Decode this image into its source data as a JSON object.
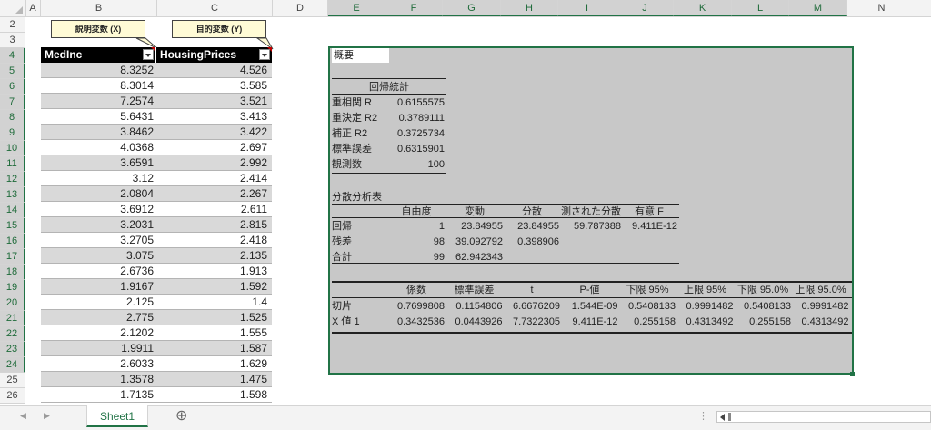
{
  "columns": [
    "A",
    "B",
    "C",
    "D",
    "E",
    "F",
    "G",
    "H",
    "I",
    "J",
    "K",
    "L",
    "M",
    "N"
  ],
  "rows": [
    "2",
    "3",
    "4",
    "5",
    "6",
    "7",
    "8",
    "9",
    "10",
    "11",
    "12",
    "13",
    "14",
    "15",
    "16",
    "17",
    "18",
    "19",
    "20",
    "21",
    "22",
    "23",
    "24",
    "25",
    "26"
  ],
  "callouts": {
    "x_label": "説明変数 (X)",
    "y_label": "目的変数 (Y)"
  },
  "table": {
    "headers": [
      "MedInc",
      "HousingPrices"
    ],
    "rows": [
      [
        "8.3252",
        "4.526"
      ],
      [
        "8.3014",
        "3.585"
      ],
      [
        "7.2574",
        "3.521"
      ],
      [
        "5.6431",
        "3.413"
      ],
      [
        "3.8462",
        "3.422"
      ],
      [
        "4.0368",
        "2.697"
      ],
      [
        "3.6591",
        "2.992"
      ],
      [
        "3.12",
        "2.414"
      ],
      [
        "2.0804",
        "2.267"
      ],
      [
        "3.6912",
        "2.611"
      ],
      [
        "3.2031",
        "2.815"
      ],
      [
        "3.2705",
        "2.418"
      ],
      [
        "3.075",
        "2.135"
      ],
      [
        "2.6736",
        "1.913"
      ],
      [
        "1.9167",
        "1.592"
      ],
      [
        "2.125",
        "1.4"
      ],
      [
        "2.775",
        "1.525"
      ],
      [
        "2.1202",
        "1.555"
      ],
      [
        "1.9911",
        "1.587"
      ],
      [
        "2.6033",
        "1.629"
      ],
      [
        "1.3578",
        "1.475"
      ],
      [
        "1.7135",
        "1.598"
      ]
    ]
  },
  "summary": {
    "title": "概要",
    "regression_stats_title": "回帰統計",
    "regression_stats": [
      {
        "label": "重相関 R",
        "value": "0.6155575"
      },
      {
        "label": "重決定 R2",
        "value": "0.3789111"
      },
      {
        "label": "補正 R2",
        "value": "0.3725734"
      },
      {
        "label": "標準誤差",
        "value": "0.6315901"
      },
      {
        "label": "観測数",
        "value": "100"
      }
    ],
    "anova_title": "分散分析表",
    "anova_headers": [
      "自由度",
      "変動",
      "分散",
      "測された分散",
      "有意 F"
    ],
    "anova_rows": [
      {
        "label": "回帰",
        "cells": [
          "1",
          "23.84955",
          "23.84955",
          "59.787388",
          "9.411E-12"
        ]
      },
      {
        "label": "残差",
        "cells": [
          "98",
          "39.092792",
          "0.398906",
          "",
          ""
        ]
      },
      {
        "label": "合計",
        "cells": [
          "99",
          "62.942343",
          "",
          "",
          ""
        ]
      }
    ],
    "coef_headers": [
      "係数",
      "標準誤差",
      "t",
      "P-値",
      "下限 95%",
      "上限 95%",
      "下限 95.0%",
      "上限 95.0%"
    ],
    "coef_rows": [
      {
        "label": "切片",
        "cells": [
          "0.7699808",
          "0.1154806",
          "6.6676209",
          "1.544E-09",
          "0.5408133",
          "0.9991482",
          "0.5408133",
          "0.9991482"
        ]
      },
      {
        "label": "X 値 1",
        "cells": [
          "0.3432536",
          "0.0443926",
          "7.7322305",
          "9.411E-12",
          "0.255158",
          "0.4313492",
          "0.255158",
          "0.4313492"
        ]
      }
    ]
  },
  "sheet_tab": "Sheet1",
  "add_sheet_label": "⊕",
  "nav_prev": "◀",
  "nav_next": "▶",
  "accent_color": "#217346"
}
